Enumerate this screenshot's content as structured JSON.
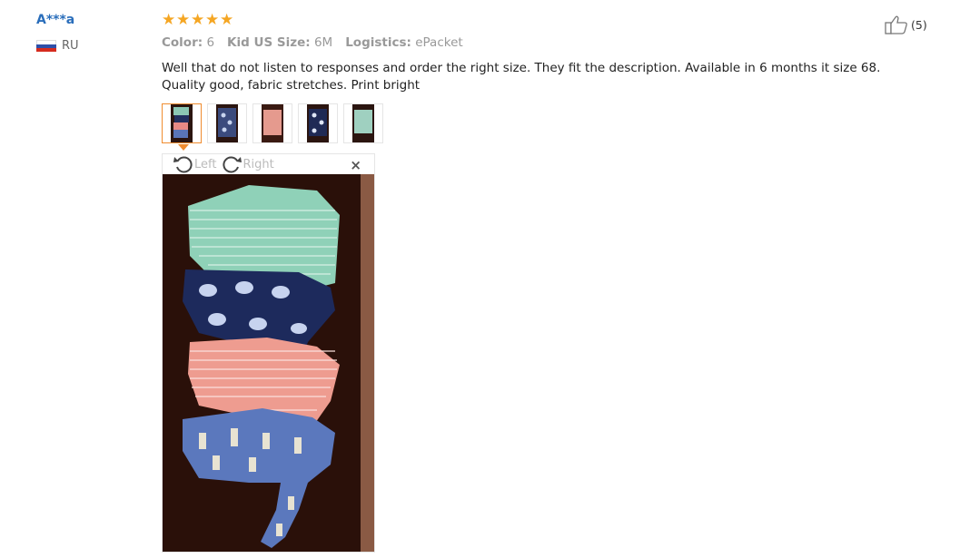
{
  "review": {
    "author": "A***a",
    "country": "RU",
    "rating": 5,
    "meta": {
      "color_label": "Color:",
      "color_value": "6",
      "size_label": "Kid US Size:",
      "size_value": "6M",
      "logistics_label": "Logistics:",
      "logistics_value": "ePacket"
    },
    "text": "Well that do not listen to responses and order the right size. They fit the description. Available in 6 months it size 68. Quality good, fabric stretches. Print bright",
    "helpful_count": "(5)"
  },
  "viewer": {
    "rotate_left": "Left",
    "rotate_right": "Right",
    "close": "×"
  },
  "thumbnails": [
    {
      "selected": true
    },
    {
      "selected": false
    },
    {
      "selected": false
    },
    {
      "selected": false
    },
    {
      "selected": false
    }
  ],
  "colors": {
    "accent": "#f08c2f",
    "author": "#2a6ebb",
    "star": "#f5a623"
  }
}
